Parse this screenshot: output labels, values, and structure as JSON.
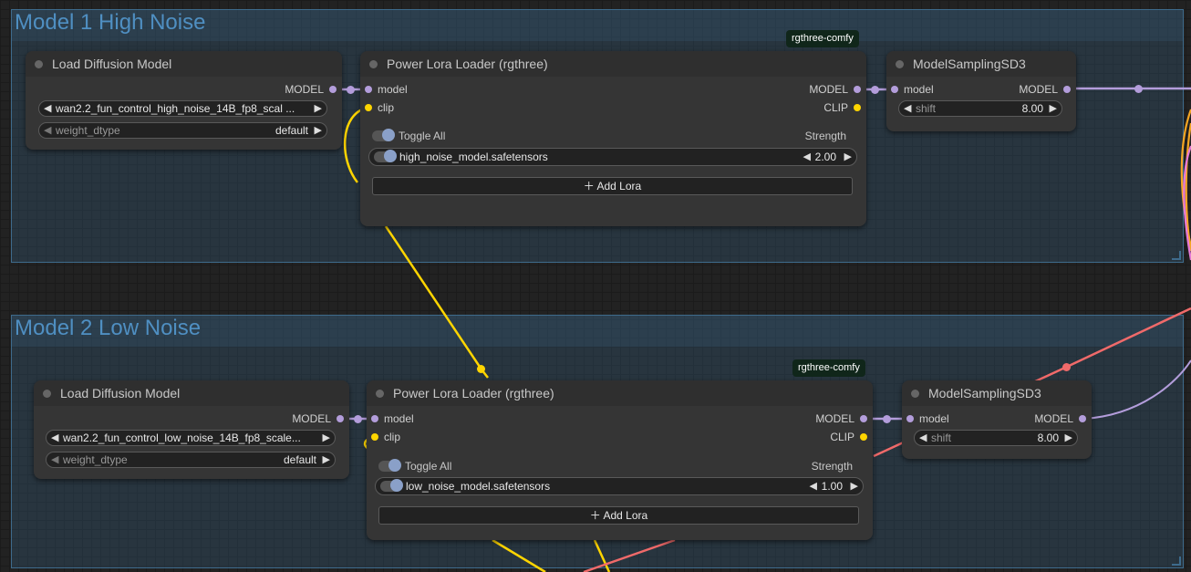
{
  "groups": [
    {
      "title": "Model 1 High Noise"
    },
    {
      "title": "Model 2 Low Noise"
    }
  ],
  "row1": {
    "load": {
      "title": "Load Diffusion Model",
      "output": "MODEL",
      "unet_name": "wan2.2_fun_control_high_noise_14B_fp8_scal ...",
      "weight_dtype_label": "weight_dtype",
      "weight_dtype_value": "default"
    },
    "lora": {
      "badge": "rgthree-comfy",
      "title": "Power Lora Loader (rgthree)",
      "in_model": "model",
      "in_clip": "clip",
      "out_model": "MODEL",
      "out_clip": "CLIP",
      "toggle_all": "Toggle All",
      "strength_header": "Strength",
      "lora_name": "high_noise_model.safetensors",
      "lora_strength": "2.00",
      "add_lora": "Add Lora"
    },
    "sampling": {
      "title": "ModelSamplingSD3",
      "in_model": "model",
      "out_model": "MODEL",
      "shift_label": "shift",
      "shift_value": "8.00"
    }
  },
  "row2": {
    "load": {
      "title": "Load Diffusion Model",
      "output": "MODEL",
      "unet_name": "wan2.2_fun_control_low_noise_14B_fp8_scale...",
      "weight_dtype_label": "weight_dtype",
      "weight_dtype_value": "default"
    },
    "lora": {
      "badge": "rgthree-comfy",
      "title": "Power Lora Loader (rgthree)",
      "in_model": "model",
      "in_clip": "clip",
      "out_model": "MODEL",
      "out_clip": "CLIP",
      "toggle_all": "Toggle All",
      "strength_header": "Strength",
      "lora_name": "low_noise_model.safetensors",
      "lora_strength": "1.00",
      "add_lora": "Add Lora"
    },
    "sampling": {
      "title": "ModelSamplingSD3",
      "in_model": "model",
      "out_model": "MODEL",
      "shift_label": "shift",
      "shift_value": "8.00"
    }
  },
  "colors": {
    "model_wire": "#b39ddb",
    "clip_wire": "#ffd500",
    "red_wire": "#f06a6a",
    "orange_wire": "#f5a623",
    "pink_wire": "#e67ad8",
    "group_title": "#4f8fc2"
  }
}
